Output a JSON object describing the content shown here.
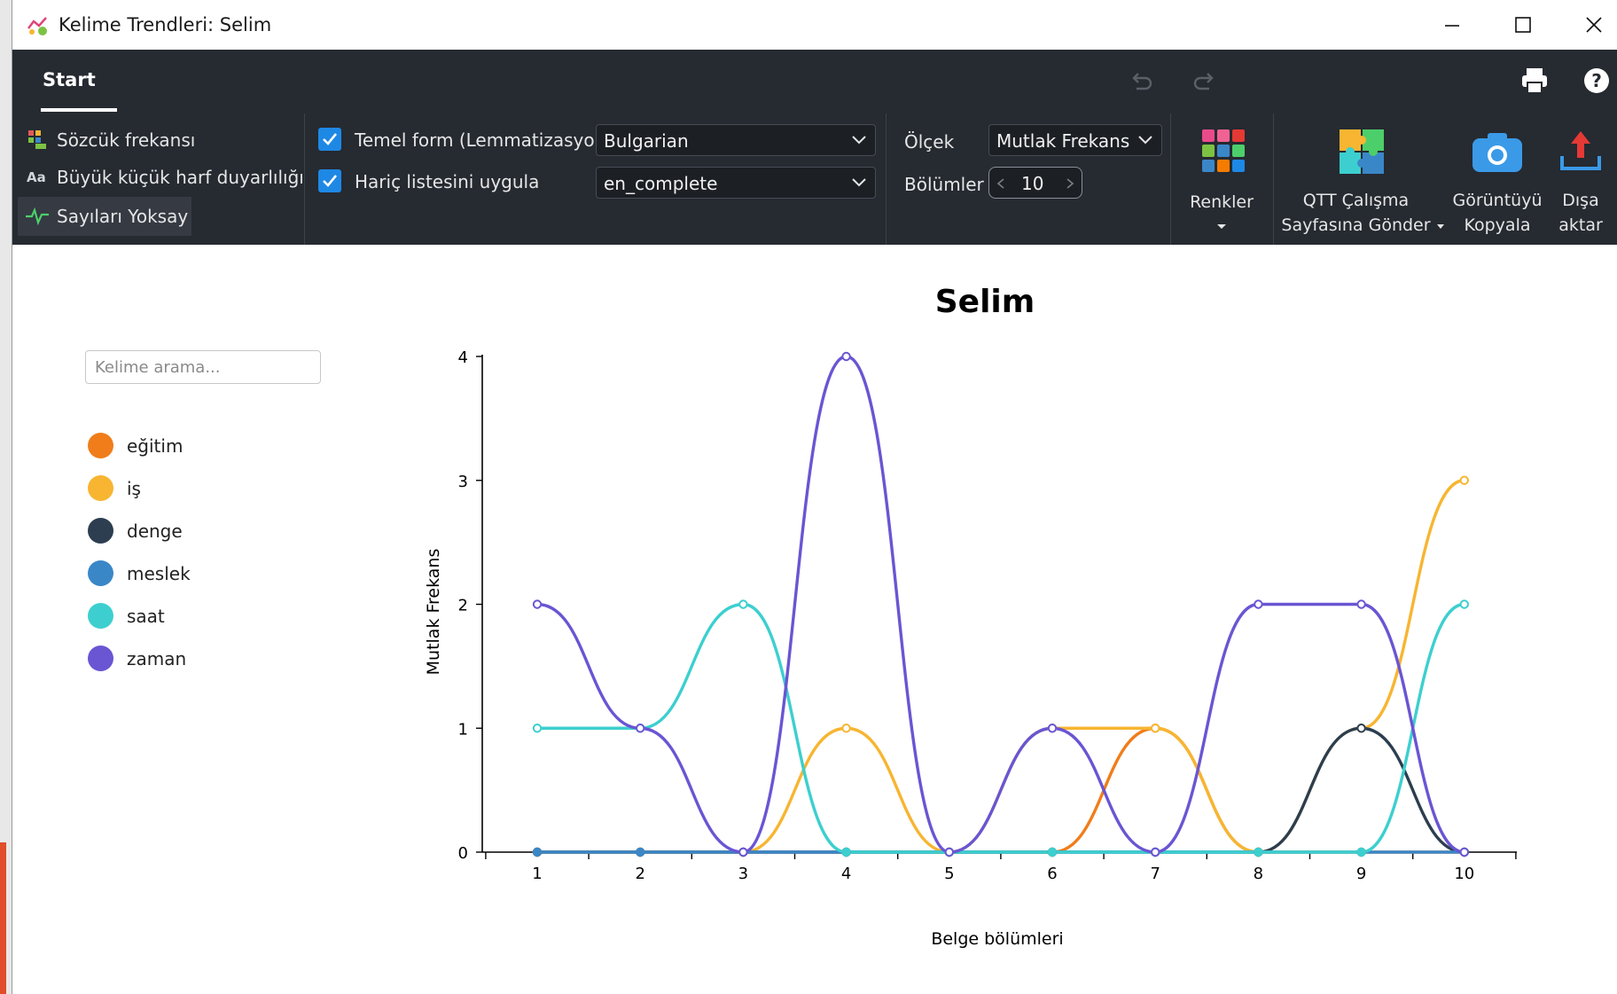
{
  "window": {
    "title": "Kelime Trendleri: Selim"
  },
  "ribbon": {
    "tab": "Start",
    "options": {
      "word_frequency": "Sözcük frekansı",
      "case_sensitivity": "Büyük küçük harf duyarlılığı",
      "ignore_numbers": "Sayıları Yoksay",
      "lemmatization": "Temel form (Lemmatizasyon)",
      "lemmatization_checked": true,
      "lemmatization_language": "Bulgarian",
      "exclusion_list": "Hariç listesini uygula",
      "exclusion_checked": true,
      "exclusion_value": "en_complete",
      "scale_label": "Ölçek",
      "scale_value": "Mutlak Frekans",
      "sections_label": "Bölümler",
      "sections_value": "10"
    },
    "buttons": {
      "colors": "Renkler",
      "qtt_line1": "QTT Çalışma",
      "qtt_line2": "Sayfasına Gönder",
      "copy_line1": "Görüntüyü",
      "copy_line2": "Kopyala",
      "export_line1": "Dışa",
      "export_line2": "aktar"
    }
  },
  "sidebar": {
    "search_placeholder": "Kelime arama...",
    "legend": [
      {
        "label": "eğitim",
        "color": "#f07d1a"
      },
      {
        "label": "iş",
        "color": "#f7b531"
      },
      {
        "label": "denge",
        "color": "#2c3e50"
      },
      {
        "label": "meslek",
        "color": "#3a87c8"
      },
      {
        "label": "saat",
        "color": "#3dcfcf"
      },
      {
        "label": "zaman",
        "color": "#6a55d3"
      }
    ]
  },
  "chart_data": {
    "type": "line",
    "title": "Selim",
    "xlabel": "Belge bölümleri",
    "ylabel": "Mutlak Frekans",
    "x": [
      1,
      2,
      3,
      4,
      5,
      6,
      7,
      8,
      9,
      10
    ],
    "ylim": [
      0,
      4
    ],
    "yticks": [
      0,
      1,
      2,
      3,
      4
    ],
    "legend": "left",
    "series": [
      {
        "name": "eğitim",
        "color": "#f07d1a",
        "values": [
          0,
          0,
          0,
          0,
          0,
          0,
          1,
          0,
          0,
          0
        ]
      },
      {
        "name": "iş",
        "color": "#f7b531",
        "values": [
          0,
          0,
          0,
          1,
          0,
          1,
          1,
          0,
          1,
          3
        ]
      },
      {
        "name": "denge",
        "color": "#2c3e50",
        "values": [
          0,
          0,
          0,
          0,
          0,
          0,
          0,
          0,
          1,
          0
        ]
      },
      {
        "name": "meslek",
        "color": "#3a87c8",
        "values": [
          0,
          0,
          0,
          0,
          0,
          0,
          0,
          0,
          0,
          0
        ]
      },
      {
        "name": "saat",
        "color": "#3dcfcf",
        "values": [
          1,
          1,
          2,
          0,
          0,
          0,
          0,
          0,
          0,
          2
        ]
      },
      {
        "name": "zaman",
        "color": "#6a55d3",
        "values": [
          2,
          1,
          0,
          4,
          0,
          1,
          0,
          2,
          2,
          0
        ]
      }
    ]
  }
}
